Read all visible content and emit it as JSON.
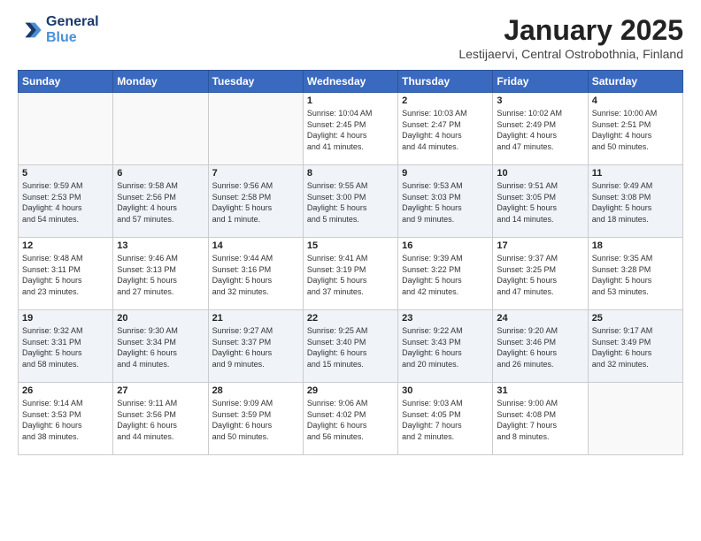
{
  "logo": {
    "line1": "General",
    "line2": "Blue"
  },
  "title": "January 2025",
  "location": "Lestijaervi, Central Ostrobothnia, Finland",
  "weekdays": [
    "Sunday",
    "Monday",
    "Tuesday",
    "Wednesday",
    "Thursday",
    "Friday",
    "Saturday"
  ],
  "weeks": [
    [
      {
        "day": "",
        "detail": ""
      },
      {
        "day": "",
        "detail": ""
      },
      {
        "day": "",
        "detail": ""
      },
      {
        "day": "1",
        "detail": "Sunrise: 10:04 AM\nSunset: 2:45 PM\nDaylight: 4 hours\nand 41 minutes."
      },
      {
        "day": "2",
        "detail": "Sunrise: 10:03 AM\nSunset: 2:47 PM\nDaylight: 4 hours\nand 44 minutes."
      },
      {
        "day": "3",
        "detail": "Sunrise: 10:02 AM\nSunset: 2:49 PM\nDaylight: 4 hours\nand 47 minutes."
      },
      {
        "day": "4",
        "detail": "Sunrise: 10:00 AM\nSunset: 2:51 PM\nDaylight: 4 hours\nand 50 minutes."
      }
    ],
    [
      {
        "day": "5",
        "detail": "Sunrise: 9:59 AM\nSunset: 2:53 PM\nDaylight: 4 hours\nand 54 minutes."
      },
      {
        "day": "6",
        "detail": "Sunrise: 9:58 AM\nSunset: 2:56 PM\nDaylight: 4 hours\nand 57 minutes."
      },
      {
        "day": "7",
        "detail": "Sunrise: 9:56 AM\nSunset: 2:58 PM\nDaylight: 5 hours\nand 1 minute."
      },
      {
        "day": "8",
        "detail": "Sunrise: 9:55 AM\nSunset: 3:00 PM\nDaylight: 5 hours\nand 5 minutes."
      },
      {
        "day": "9",
        "detail": "Sunrise: 9:53 AM\nSunset: 3:03 PM\nDaylight: 5 hours\nand 9 minutes."
      },
      {
        "day": "10",
        "detail": "Sunrise: 9:51 AM\nSunset: 3:05 PM\nDaylight: 5 hours\nand 14 minutes."
      },
      {
        "day": "11",
        "detail": "Sunrise: 9:49 AM\nSunset: 3:08 PM\nDaylight: 5 hours\nand 18 minutes."
      }
    ],
    [
      {
        "day": "12",
        "detail": "Sunrise: 9:48 AM\nSunset: 3:11 PM\nDaylight: 5 hours\nand 23 minutes."
      },
      {
        "day": "13",
        "detail": "Sunrise: 9:46 AM\nSunset: 3:13 PM\nDaylight: 5 hours\nand 27 minutes."
      },
      {
        "day": "14",
        "detail": "Sunrise: 9:44 AM\nSunset: 3:16 PM\nDaylight: 5 hours\nand 32 minutes."
      },
      {
        "day": "15",
        "detail": "Sunrise: 9:41 AM\nSunset: 3:19 PM\nDaylight: 5 hours\nand 37 minutes."
      },
      {
        "day": "16",
        "detail": "Sunrise: 9:39 AM\nSunset: 3:22 PM\nDaylight: 5 hours\nand 42 minutes."
      },
      {
        "day": "17",
        "detail": "Sunrise: 9:37 AM\nSunset: 3:25 PM\nDaylight: 5 hours\nand 47 minutes."
      },
      {
        "day": "18",
        "detail": "Sunrise: 9:35 AM\nSunset: 3:28 PM\nDaylight: 5 hours\nand 53 minutes."
      }
    ],
    [
      {
        "day": "19",
        "detail": "Sunrise: 9:32 AM\nSunset: 3:31 PM\nDaylight: 5 hours\nand 58 minutes."
      },
      {
        "day": "20",
        "detail": "Sunrise: 9:30 AM\nSunset: 3:34 PM\nDaylight: 6 hours\nand 4 minutes."
      },
      {
        "day": "21",
        "detail": "Sunrise: 9:27 AM\nSunset: 3:37 PM\nDaylight: 6 hours\nand 9 minutes."
      },
      {
        "day": "22",
        "detail": "Sunrise: 9:25 AM\nSunset: 3:40 PM\nDaylight: 6 hours\nand 15 minutes."
      },
      {
        "day": "23",
        "detail": "Sunrise: 9:22 AM\nSunset: 3:43 PM\nDaylight: 6 hours\nand 20 minutes."
      },
      {
        "day": "24",
        "detail": "Sunrise: 9:20 AM\nSunset: 3:46 PM\nDaylight: 6 hours\nand 26 minutes."
      },
      {
        "day": "25",
        "detail": "Sunrise: 9:17 AM\nSunset: 3:49 PM\nDaylight: 6 hours\nand 32 minutes."
      }
    ],
    [
      {
        "day": "26",
        "detail": "Sunrise: 9:14 AM\nSunset: 3:53 PM\nDaylight: 6 hours\nand 38 minutes."
      },
      {
        "day": "27",
        "detail": "Sunrise: 9:11 AM\nSunset: 3:56 PM\nDaylight: 6 hours\nand 44 minutes."
      },
      {
        "day": "28",
        "detail": "Sunrise: 9:09 AM\nSunset: 3:59 PM\nDaylight: 6 hours\nand 50 minutes."
      },
      {
        "day": "29",
        "detail": "Sunrise: 9:06 AM\nSunset: 4:02 PM\nDaylight: 6 hours\nand 56 minutes."
      },
      {
        "day": "30",
        "detail": "Sunrise: 9:03 AM\nSunset: 4:05 PM\nDaylight: 7 hours\nand 2 minutes."
      },
      {
        "day": "31",
        "detail": "Sunrise: 9:00 AM\nSunset: 4:08 PM\nDaylight: 7 hours\nand 8 minutes."
      },
      {
        "day": "",
        "detail": ""
      }
    ]
  ]
}
